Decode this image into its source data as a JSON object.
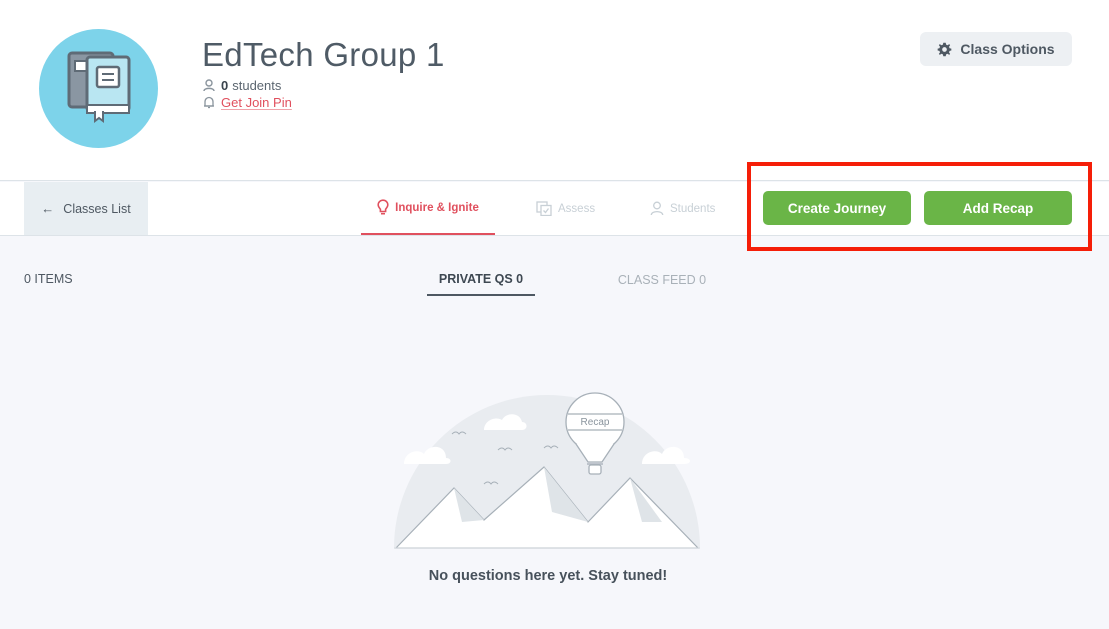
{
  "header": {
    "class_title": "EdTech Group 1",
    "student_count": "0",
    "students_label": "students",
    "join_pin_label": "Get Join Pin",
    "class_options_label": "Class Options"
  },
  "tabbar": {
    "classes_list_label": "Classes List",
    "tabs": [
      {
        "label": "Inquire & Ignite",
        "icon": "lightbulb-icon",
        "active": true
      },
      {
        "label": "Assess",
        "icon": "assess-icon",
        "active": false
      },
      {
        "label": "Students",
        "icon": "user-icon",
        "active": false
      }
    ],
    "create_journey_label": "Create Journey",
    "add_recap_label": "Add Recap"
  },
  "content": {
    "items_count": "0 ITEMS",
    "sub_tabs": [
      {
        "label": "PRIVATE QS 0",
        "active": true
      },
      {
        "label": "CLASS FEED 0",
        "active": false
      }
    ],
    "balloon_label": "Recap",
    "empty_message": "No questions here yet. Stay tuned!"
  },
  "colors": {
    "accent_red": "#e0505e",
    "button_green": "#6ab547",
    "avatar_blue": "#7dd3ea",
    "annotation_red": "#f51e08"
  }
}
